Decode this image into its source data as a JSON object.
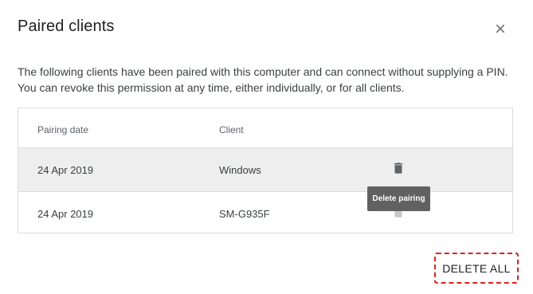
{
  "dialog": {
    "title": "Paired clients",
    "close_icon": "close-icon",
    "description_line1": "The following clients have been paired with this computer and can connect without supplying a PIN.",
    "description_line2": "You can revoke this permission at any time, either individually, or for all clients."
  },
  "table": {
    "headers": {
      "date": "Pairing date",
      "client": "Client"
    },
    "rows": [
      {
        "date": "24 Apr 2019",
        "client": "Windows",
        "action_icon": "trash-icon"
      },
      {
        "date": "24 Apr 2019",
        "client": "SM-G935F",
        "action_icon": "trash-icon"
      }
    ]
  },
  "tooltip": {
    "text": "Delete pairing"
  },
  "footer": {
    "delete_all_label": "DELETE ALL"
  },
  "colors": {
    "highlight_row": "#eeeeee",
    "tooltip_bg": "#616161",
    "annotation_dash": "#e02020"
  }
}
